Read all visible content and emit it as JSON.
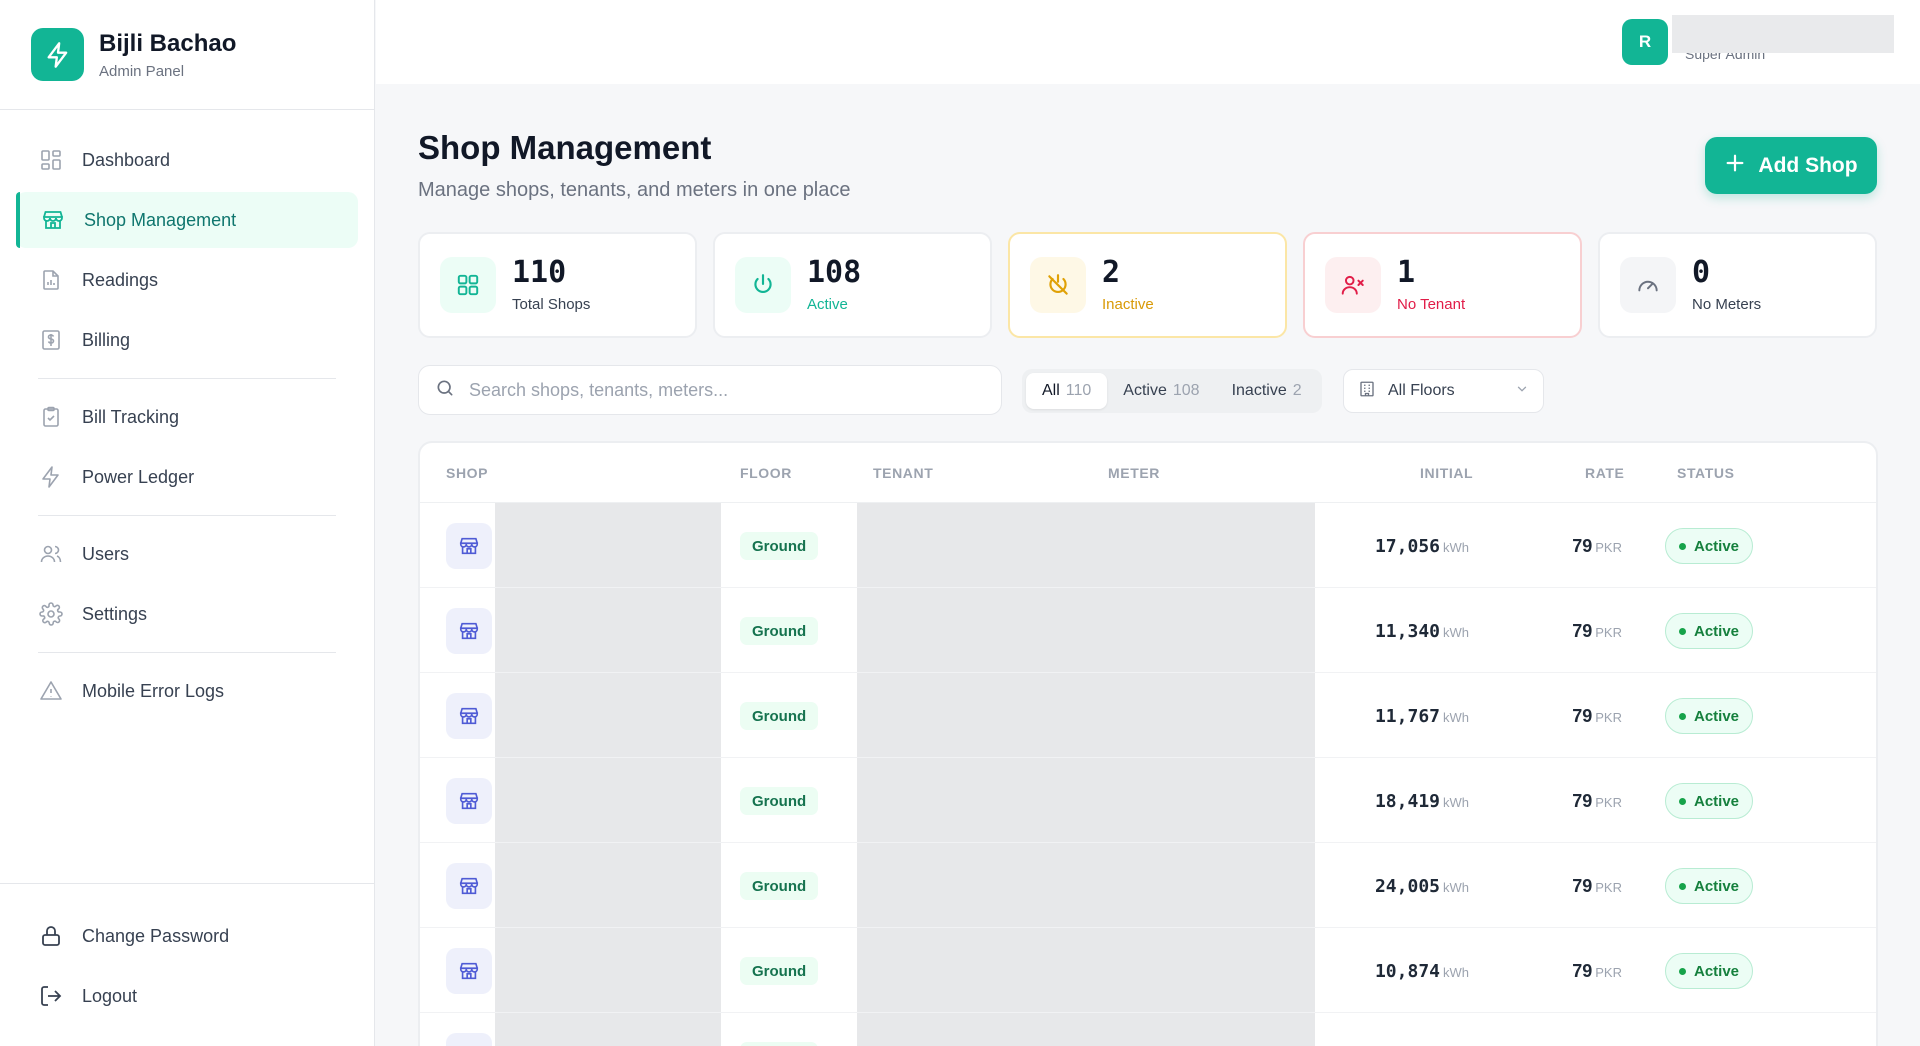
{
  "brand": {
    "title": "Bijli Bachao",
    "subtitle": "Admin Panel",
    "color": "#12b595"
  },
  "nav": [
    {
      "label": "Dashboard",
      "icon": "dashboard-icon",
      "active": false
    },
    {
      "label": "Shop Management",
      "icon": "store-icon",
      "active": true
    },
    {
      "label": "Readings",
      "icon": "readings-icon",
      "active": false
    },
    {
      "label": "Billing",
      "icon": "billing-icon",
      "active": false
    },
    {
      "label": "Bill Tracking",
      "icon": "clipboard-check-icon",
      "active": false
    },
    {
      "label": "Power Ledger",
      "icon": "lightning-icon",
      "active": false
    },
    {
      "label": "Users",
      "icon": "users-icon",
      "active": false
    },
    {
      "label": "Settings",
      "icon": "gear-icon",
      "active": false
    },
    {
      "label": "Mobile Error Logs",
      "icon": "warning-icon",
      "active": false
    }
  ],
  "bottom_nav": [
    {
      "label": "Change Password",
      "icon": "lock-icon"
    },
    {
      "label": "Logout",
      "icon": "logout-icon"
    }
  ],
  "user": {
    "initial": "R",
    "role": "Super Admin"
  },
  "page": {
    "title": "Shop Management",
    "subtitle": "Manage shops, tenants, and meters in one place",
    "add_button": "Add Shop"
  },
  "stats": [
    {
      "value": "110",
      "label": "Total Shops",
      "icon": "grid-icon",
      "color": "#111827"
    },
    {
      "value": "108",
      "label": "Active",
      "icon": "power-icon",
      "color": "#12b595"
    },
    {
      "value": "2",
      "label": "Inactive",
      "icon": "power-off-icon",
      "color": "#d99a06"
    },
    {
      "value": "1",
      "label": "No Tenant",
      "icon": "user-x-icon",
      "color": "#e11d48"
    },
    {
      "value": "0",
      "label": "No Meters",
      "icon": "gauge-icon",
      "color": "#374151"
    }
  ],
  "search": {
    "placeholder": "Search shops, tenants, meters..."
  },
  "filters": [
    {
      "label": "All",
      "count": "110",
      "active": true
    },
    {
      "label": "Active",
      "count": "108",
      "active": false
    },
    {
      "label": "Inactive",
      "count": "2",
      "active": false
    }
  ],
  "floor_select": {
    "value": "All Floors"
  },
  "table": {
    "headers": {
      "shop": "SHOP",
      "floor": "FLOOR",
      "tenant": "TENANT",
      "meter": "METER",
      "initial": "INITIAL",
      "rate": "RATE",
      "status": "STATUS"
    },
    "rows": [
      {
        "floor": "Ground",
        "initial": "17,056",
        "initial_unit": "kWh",
        "rate": "79",
        "rate_unit": "PKR",
        "status": "Active"
      },
      {
        "floor": "Ground",
        "initial": "11,340",
        "initial_unit": "kWh",
        "rate": "79",
        "rate_unit": "PKR",
        "status": "Active"
      },
      {
        "floor": "Ground",
        "initial": "11,767",
        "initial_unit": "kWh",
        "rate": "79",
        "rate_unit": "PKR",
        "status": "Active"
      },
      {
        "floor": "Ground",
        "initial": "18,419",
        "initial_unit": "kWh",
        "rate": "79",
        "rate_unit": "PKR",
        "status": "Active"
      },
      {
        "floor": "Ground",
        "initial": "24,005",
        "initial_unit": "kWh",
        "rate": "79",
        "rate_unit": "PKR",
        "status": "Active"
      },
      {
        "floor": "Ground",
        "initial": "10,874",
        "initial_unit": "kWh",
        "rate": "79",
        "rate_unit": "PKR",
        "status": "Active"
      },
      {
        "floor": "Ground",
        "initial": "",
        "initial_unit": "",
        "rate": "",
        "rate_unit": "",
        "status": ""
      }
    ]
  }
}
